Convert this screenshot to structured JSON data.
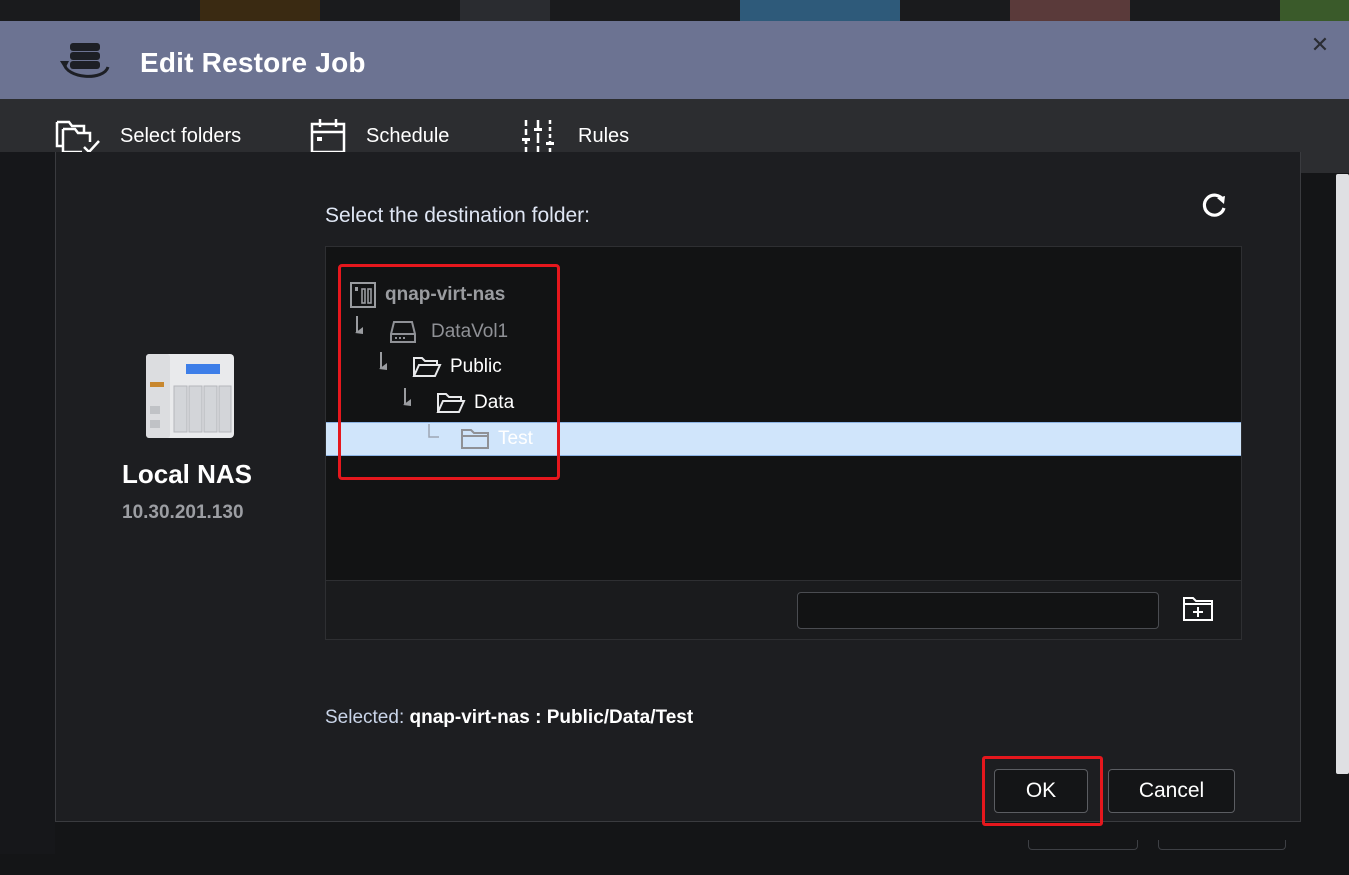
{
  "dialog": {
    "title": "Edit Restore Job",
    "close_label": "✕"
  },
  "tabs": [
    {
      "label": "Select folders",
      "icon": "folder-check-icon"
    },
    {
      "label": "Schedule",
      "icon": "calendar-icon"
    },
    {
      "label": "Rules",
      "icon": "sliders-icon"
    }
  ],
  "source": {
    "name": "Local NAS",
    "ip": "10.30.201.130"
  },
  "destination": {
    "prompt": "Select the destination folder:",
    "tree": [
      {
        "label": "qnap-virt-nas",
        "level": 0,
        "icon": "nas-server-icon"
      },
      {
        "label": "DataVol1",
        "level": 1,
        "icon": "disk-volume-icon"
      },
      {
        "label": "Public",
        "level": 2,
        "icon": "folder-open-icon"
      },
      {
        "label": "Data",
        "level": 3,
        "icon": "folder-open-icon"
      },
      {
        "label": "Test",
        "level": 4,
        "icon": "folder-icon",
        "selected": true
      }
    ],
    "new_folder_value": "",
    "selected_label": "Selected:",
    "selected_value": "qnap-virt-nas : Public/Data/Test"
  },
  "buttons": {
    "ok": "OK",
    "cancel": "Cancel"
  },
  "colors": {
    "titlebar": "#6c7392",
    "selection": "#d0e5fb",
    "highlight_box": "#e5171d"
  }
}
